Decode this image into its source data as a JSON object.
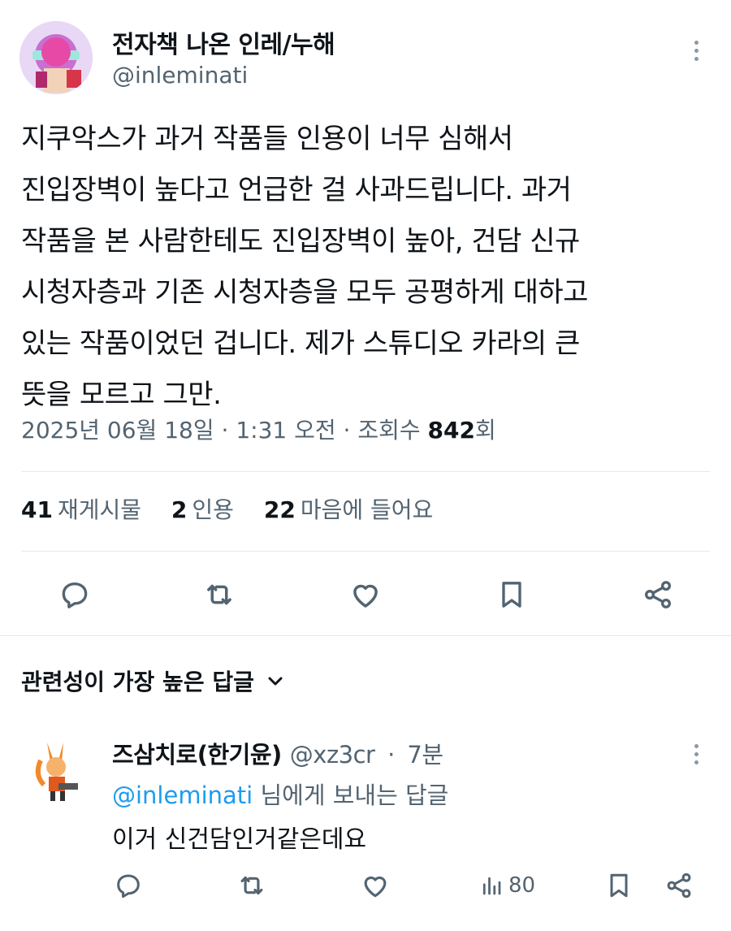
{
  "tweet": {
    "author_name": "전자책 나온 인레/누해",
    "author_handle": "@inleminati",
    "text": "지쿠악스가 과거 작품들 인용이 너무 심해서\n진입장벽이 높다고 언급한 걸 사과드립니다. 과거\n작품을 본 사람한테도 진입장벽이 높아, 건담 신규\n시청자층과 기존 시청자층을 모두 공평하게 대하고\n있는 작품이었던 겁니다. 제가 스튜디오 카라의 큰\n뜻을 모르고 그만.",
    "date": "2025년 06월 18일",
    "time": "1:31 오전",
    "views_label": "조회수",
    "views_count": "842",
    "views_suffix": "회",
    "separator": "·",
    "stats": {
      "reposts_count": "41",
      "reposts_label": "재게시물",
      "quotes_count": "2",
      "quotes_label": "인용",
      "likes_count": "22",
      "likes_label": "마음에 들어요"
    },
    "actions": [
      "reply-icon",
      "repost-icon",
      "like-icon",
      "bookmark-icon",
      "share-icon"
    ]
  },
  "replies_sort": {
    "label": "관련성이 가장 높은 답글",
    "icon": "chevron-down-icon"
  },
  "reply": {
    "author_name": "즈삼치로(한기윤)",
    "author_handle": "@xz3cr",
    "separator": "·",
    "time": "7분",
    "reply_to_handle": "@inleminati",
    "reply_to_suffix": "님에게 보내는 답글",
    "text": "이거 신건담인거같은데요",
    "views": "80"
  },
  "colors": {
    "text": "#0f1419",
    "muted": "#536471",
    "link": "#1d9bf0",
    "divider": "#e6e9ec"
  }
}
